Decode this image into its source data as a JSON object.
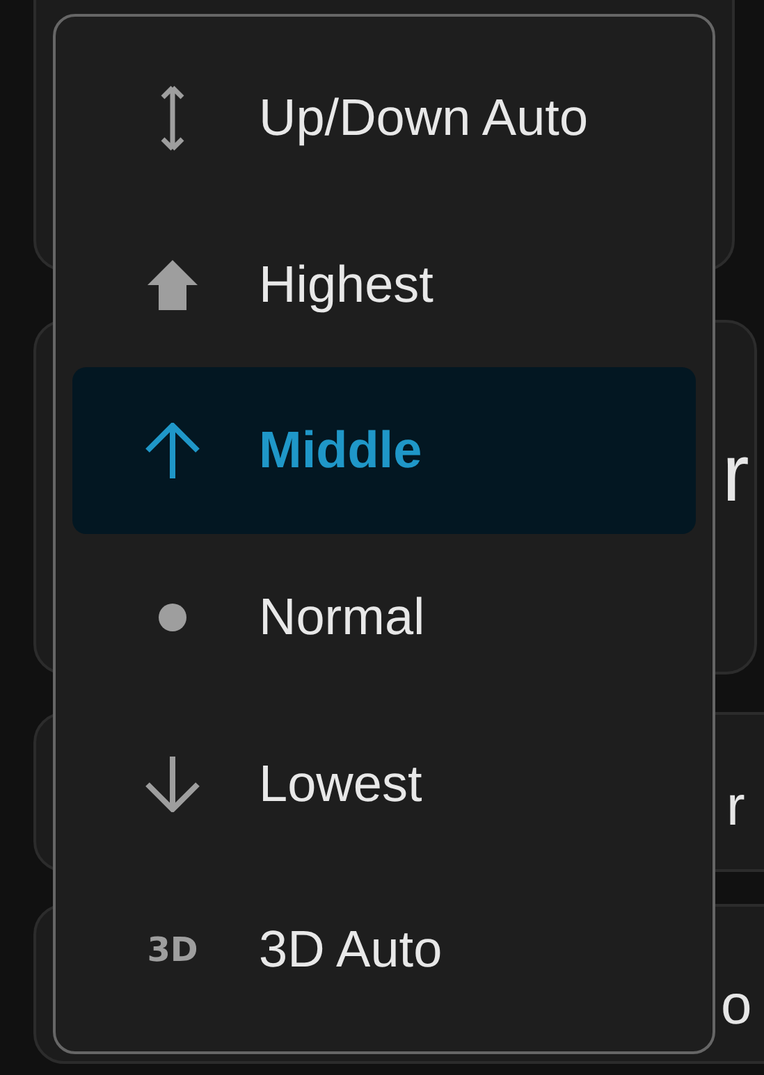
{
  "background_cards": [
    {
      "text": "r"
    },
    {
      "text": "r"
    },
    {
      "text": "o"
    }
  ],
  "menu": {
    "items": [
      {
        "label": "Up/Down Auto",
        "kind": "updown",
        "selected": false
      },
      {
        "label": "Highest",
        "kind": "bold-up",
        "selected": false
      },
      {
        "label": "Middle",
        "kind": "up",
        "selected": true
      },
      {
        "label": "Normal",
        "kind": "dot",
        "selected": false
      },
      {
        "label": "Lowest",
        "kind": "down",
        "selected": false
      },
      {
        "label": "3D Auto",
        "kind": "threed",
        "icon_text": "3D",
        "selected": false
      }
    ]
  }
}
